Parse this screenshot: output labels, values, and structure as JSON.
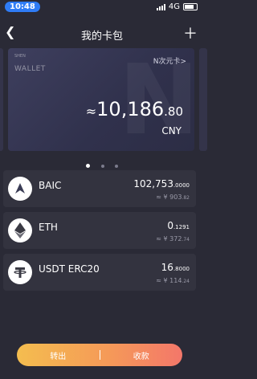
{
  "status": {
    "time": "10:48",
    "network": "4G"
  },
  "nav": {
    "title": "我的卡包"
  },
  "card": {
    "logo_small": "SHEN",
    "logo_big": "WALLET",
    "watermark": "N",
    "link": "N次元卡>",
    "approx": "≈",
    "balance_int": "10,186",
    "balance_dec": ".80",
    "currency": "CNY"
  },
  "pagination": {
    "count": 3,
    "active_index": 0
  },
  "assets": [
    {
      "name": "BAIC",
      "icon": "baic-icon",
      "amount_int": "102,753",
      "amount_frac": ".0000",
      "fiat_prefix": "≈ ¥ ",
      "fiat_int": "903",
      "fiat_frac": ".82"
    },
    {
      "name": "ETH",
      "icon": "eth-icon",
      "amount_int": "0",
      "amount_frac": ".1291",
      "fiat_prefix": "≈ ¥ ",
      "fiat_int": "372",
      "fiat_frac": ".74"
    },
    {
      "name": "USDT ERC20",
      "icon": "usdt-icon",
      "amount_int": "16",
      "amount_frac": ".8000",
      "fiat_prefix": "≈ ¥ ",
      "fiat_int": "114",
      "fiat_frac": ".24"
    }
  ],
  "actions": {
    "send": "转出",
    "receive": "收款"
  },
  "colors": {
    "accent": "#2f7cf6",
    "gradient_start": "#f4bd4f",
    "gradient_end": "#f3776a"
  }
}
